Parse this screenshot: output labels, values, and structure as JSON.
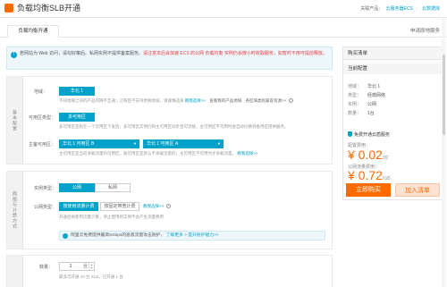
{
  "header": {
    "title": "负载均衡SLB开通",
    "related_label": "关联产品：",
    "links": [
      "云服务器ECS",
      "云数据库"
    ]
  },
  "tabs": {
    "active": "负载均衡开通",
    "right": "申请原地服务"
  },
  "notice": {
    "text": "若网站为 Web 访问，请勾好策后。私网实例不提供备案服务。",
    "warning": "请注意本后会加速 ECS 的公网 负载均衡 实例仍会按小时收取服务，如暂时不用可提前释放。"
  },
  "region": {
    "label": "地域：",
    "selected": "华北 1",
    "hint": "不同地域之间的产品内网不互通；订购后不支持更换地域，请谨慎选择",
    "hint_link1": "教我选择>>",
    "hint_link2": "查看我的产品地域",
    "hint_link3": "各区域类别兼容资源>>",
    "side_label": "基本配置"
  },
  "zone_type": {
    "label": "可用区类型：",
    "selected": "多可用区",
    "hint": "多可用区是指在一个可用区下发后，多可用区实例仍和主可用区同步且可流接，主可用区不可用时会自动切换到备用区提供服务。"
  },
  "zones": {
    "label": "主备可用区：",
    "primary": "华北 1 可用区 B",
    "backup": "华北 1 可用区 A",
    "hint": "主可用区是当前承载流量的可用区，备可用区是默认不承载流量的；主可用区不可用时才承载流量。",
    "hint_link": "教我选择>>"
  },
  "instance_type": {
    "label": "实例类型：",
    "options": [
      "公网",
      "私网"
    ],
    "selected": "公网",
    "side_label": "网络与计费方式"
  },
  "billing": {
    "label": "公网类型：",
    "options": [
      "按使用流量计费",
      "按固定带宽计费"
    ],
    "selected": "按使用流量计费",
    "hint_link": "教我选择>>",
    "hint": "开通后按使用流量计算，停止使用则实例不会产生流量费用"
  },
  "tip": {
    "text": "阿里云免费提供最高5Gbps的恶意流量攻击防护，",
    "link": "了解更多 >",
    "link2": "提升防护能力>>"
  },
  "quantity": {
    "label": "数量：",
    "value": "1",
    "unit": "台",
    "hint": "最多可开通 10 台 SLB，已开通 1 台"
  },
  "cart": {
    "head": "购买清单",
    "sub": "当前配置",
    "rows": [
      {
        "k": "地域：",
        "v": "华北 1"
      },
      {
        "k": "类型：",
        "v": "经典网络"
      },
      {
        "k": "实例：",
        "v": "公网"
      },
      {
        "k": "数量：",
        "v": "1台"
      }
    ],
    "tag": "免费开通云盾服务",
    "spec_label": "配置费用：",
    "spec_price": "¥ 0.02",
    "spec_unit": "/时",
    "traffic_label": "公网流量费用：",
    "traffic_price": "¥ 0.72",
    "traffic_unit": "/GB",
    "buy": "立即购买",
    "add": "加入清单"
  },
  "colors": {
    "accent": "#00a2ca",
    "orange": "#ff6a00"
  }
}
